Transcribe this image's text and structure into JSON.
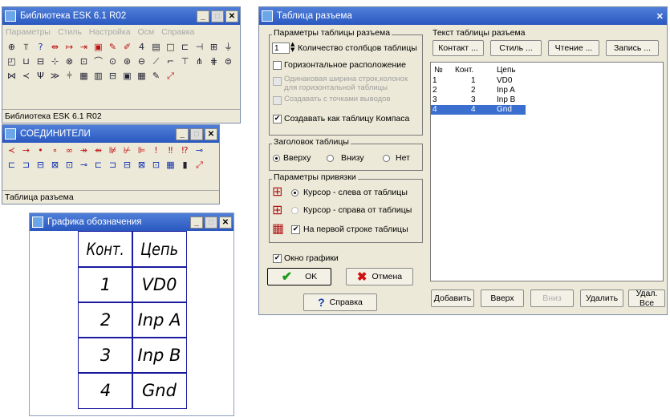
{
  "lib_window": {
    "title": "Библиотека ESK 6.1 R02",
    "menu": [
      "Параметры",
      "Стиль",
      "Настройка",
      " Осм",
      "Справка"
    ],
    "status": "Библиотека ESK 6.1 R02"
  },
  "conn_window": {
    "title": "СОЕДИНИТЕЛИ",
    "status": "Таблица разъема"
  },
  "graph_window": {
    "title": "Графика обозначения",
    "headers": [
      "Конт.",
      "Цепь"
    ],
    "rows": [
      [
        "1",
        "VD0"
      ],
      [
        "2",
        "Inp A"
      ],
      [
        "3",
        "Inp B"
      ],
      [
        "4",
        "Gnd"
      ]
    ]
  },
  "dialog": {
    "title": "Таблица разъема",
    "params_group": "Параметры таблицы разъема",
    "columns_value": "1",
    "columns_label": "Количество столбцов таблицы",
    "horizontal_label": "Горизонтальное расположение",
    "same_width_label": "Одинаковая ширина строк,колонок для горизонтальной таблицы",
    "dashed_label": "Создавать с точками выводов",
    "kompas_label": "Создавать как таблицу Компаса",
    "header_group": "Заголовок таблицы",
    "header_options": [
      "Вверху",
      "Внизу",
      "Нет"
    ],
    "bind_group": "Параметры привязки",
    "bind_left": "Курсор - слева от таблицы",
    "bind_right": "Курсор - справа от таблицы",
    "bind_first": "На первой строке таблицы",
    "graph_window_label": "Окно графики",
    "ok": "OK",
    "cancel": "Отмена",
    "help": "Справка",
    "text_group": "Текст таблицы разъема",
    "top_buttons": [
      "Контакт ...",
      "Стиль ...",
      "Чтение ...",
      "Запись ..."
    ],
    "list_headers": [
      "№",
      "Конт.",
      "Цепь"
    ],
    "list_rows": [
      [
        "1",
        "1",
        "VD0"
      ],
      [
        "2",
        "2",
        "Inp A"
      ],
      [
        "3",
        "3",
        "Inp B"
      ],
      [
        "4",
        "4",
        "Gnd"
      ]
    ],
    "bottom_buttons": [
      "Добавить",
      "Вверх",
      "Вниз",
      "Удалить",
      "Удал. Все"
    ]
  }
}
